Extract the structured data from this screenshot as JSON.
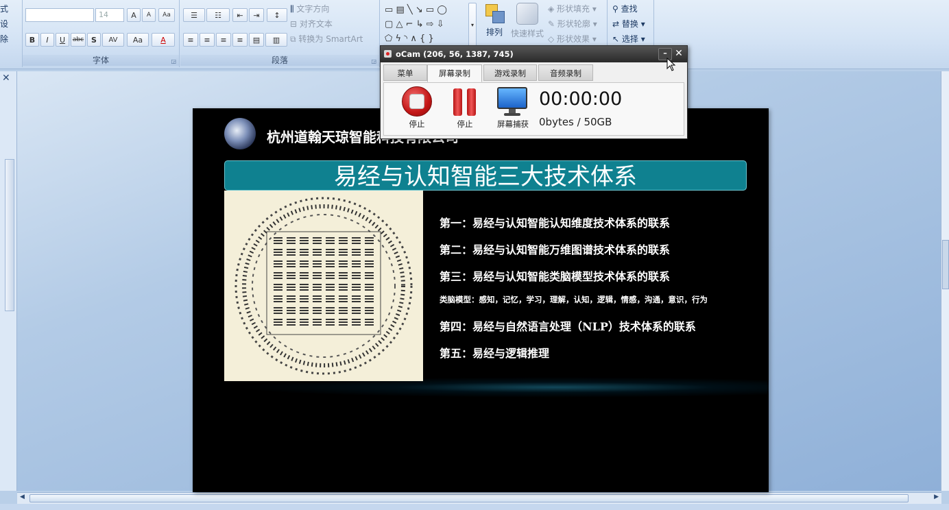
{
  "ribbon": {
    "left_partial": [
      "式",
      "设",
      "除"
    ],
    "font": {
      "font_name_value": "",
      "font_size_value": "14",
      "grow_label": "A",
      "shrink_label": "A",
      "clear_label": "Aa",
      "bold": "B",
      "italic": "I",
      "underline": "U",
      "strike": "abc",
      "shadow": "S",
      "spacing": "AV",
      "case": "Aa",
      "color_a": "A",
      "group_label": "字体"
    },
    "paragraph": {
      "text_direction": "文字方向",
      "align_text": "对齐文本",
      "smartart": "转换为 SmartArt",
      "group_label": "段落"
    },
    "drawing": {
      "arrange": "排列",
      "quick_styles": "快速样式",
      "shape_fill": "形状填充",
      "shape_outline": "形状轮廓",
      "shape_effects": "形状效果"
    },
    "editing": {
      "find": "查找",
      "replace": "替换",
      "select": "选择"
    }
  },
  "slide": {
    "company": "杭州道翰天琼智能科技有限公司",
    "banner_title": "易经与认知智能三大技术体系",
    "items": [
      "第一：易经与认知智能认知维度技术体系的联系",
      "第二：易经与认知智能万维图谱技术体系的联系",
      "第三：易经与认知智能类脑模型技术体系的联系",
      "类脑模型：感知，记忆，学习，理解，认知，逻辑，情感，沟通，意识，行为",
      "第四：易经与自然语言处理（NLP）技术体系的联系",
      "第五：易经与逻辑推理"
    ]
  },
  "ocam": {
    "title": "oCam (206, 56, 1387, 745)",
    "tabs": [
      "菜单",
      "屏幕录制",
      "游戏录制",
      "音频录制"
    ],
    "active_tab": "屏幕录制",
    "buttons": {
      "record_label": "停止",
      "pause_label": "停止",
      "capture_label": "屏幕捕获"
    },
    "time": "00:00:00",
    "size": "0bytes / 50GB"
  },
  "colors": {
    "banner": "#0f8190",
    "ribbon_bg": "#d5e4f5",
    "slide_bg": "#000000",
    "record_red": "#d42a2a"
  }
}
